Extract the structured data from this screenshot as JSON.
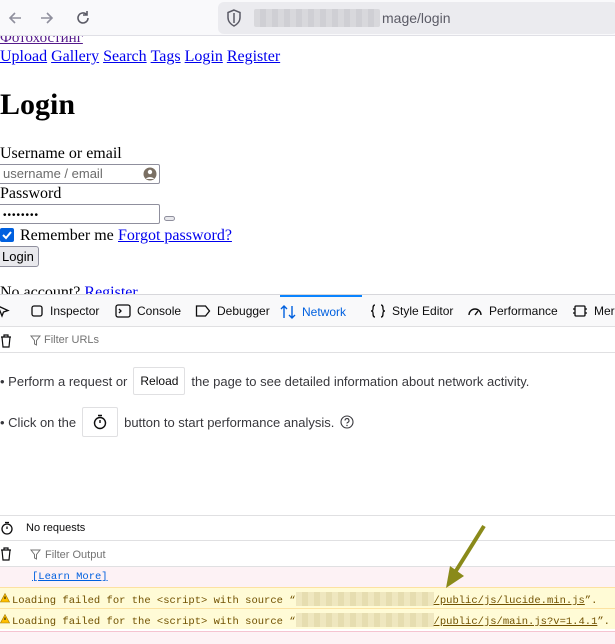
{
  "browser": {
    "url_visible": "mage/login"
  },
  "page": {
    "brand": "Фотохостинг",
    "nav": [
      "Upload",
      "Gallery",
      "Search",
      "Tags",
      "Login",
      "Register"
    ],
    "title": "Login",
    "username_label": "Username or email",
    "username_placeholder": "username / email",
    "password_label": "Password",
    "password_value": "••••••••",
    "remember_label": "Remember me",
    "remember_checked": true,
    "forgot_link": "Forgot password?",
    "login_button": "Login",
    "no_account_text": "No account?",
    "register_link": "Register"
  },
  "devtools": {
    "tabs": [
      "Inspector",
      "Console",
      "Debugger",
      "Network",
      "Style Editor",
      "Performance",
      "Mer"
    ],
    "active_tab": "Network",
    "filter_urls_placeholder": "Filter URLs",
    "msg1_before": "• Perform a request or",
    "msg1_button": "Reload",
    "msg1_after": "the page to see detailed information about network activity.",
    "msg2_before": "• Click on the",
    "msg2_after": "button to start performance analysis.",
    "status": "No requests",
    "filter_output_placeholder": "Filter Output",
    "learn_more": "[Learn More]",
    "warnings": [
      {
        "prefix": "Loading failed for the <script> with source “",
        "path": "/public/js/lucide.min.js",
        "suffix": "”."
      },
      {
        "prefix": "Loading failed for the <script> with source “",
        "path": "/public/js/main.js?v=1.4.1",
        "suffix": "”."
      }
    ]
  },
  "colors": {
    "accent": "#0060df",
    "link": "#0000ee",
    "visited": "#551a8b",
    "warning_bg": "#fffbd6",
    "annotation_arrow": "#8a8a1a"
  }
}
